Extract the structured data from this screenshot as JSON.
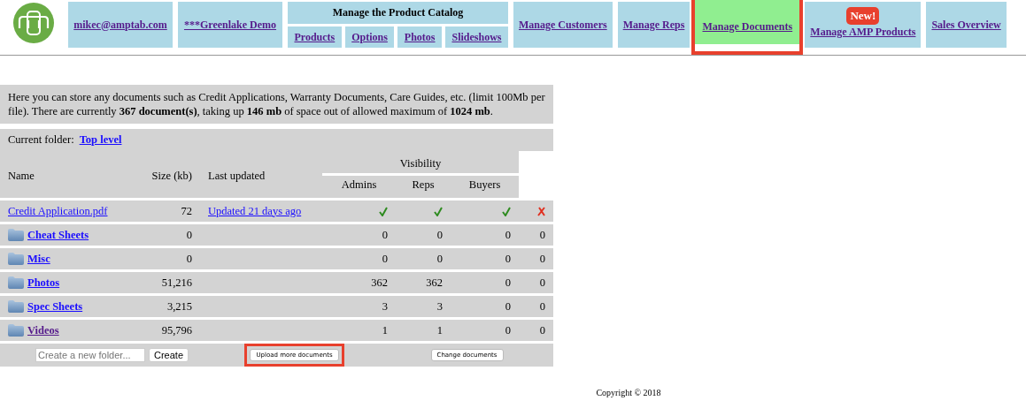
{
  "nav": {
    "user": "mikec@amptab.com",
    "account": "***Greenlake Demo",
    "catalog": {
      "title": "Manage the Product Catalog",
      "links": [
        "Products",
        "Options",
        "Photos",
        "Slideshows"
      ]
    },
    "items": [
      {
        "label": "Manage Customers",
        "selected": false,
        "highlighted": false
      },
      {
        "label": "Manage Reps",
        "selected": false,
        "highlighted": false
      },
      {
        "label": "Manage Documents",
        "selected": true,
        "highlighted": true
      },
      {
        "label": "Manage AMP Products",
        "badge": "New!",
        "selected": false,
        "highlighted": false
      },
      {
        "label": "Sales Overview",
        "selected": false,
        "highlighted": false
      }
    ]
  },
  "info": "Here you can store any documents such as Credit Applications, Warranty Documents, Care Guides, etc. (limit 100Mb per file). There are currently **367 document(s)**, taking up **146 mb** of space out of allowed maximum of **1024 mb**.",
  "current_folder": {
    "label": "Current folder:",
    "link": "Top level"
  },
  "table": {
    "columns": [
      "Name",
      "Size (kb)",
      "Last updated"
    ],
    "visibility_header": "Visibility",
    "visibility_columns": [
      "Admins",
      "Reps",
      "Buyers"
    ],
    "rows": [
      {
        "kind": "file",
        "name": "Credit Application.pdf",
        "size": "72",
        "updated": "Updated 21 days ago",
        "visited": false,
        "flags": [
          true,
          true,
          true,
          false
        ]
      },
      {
        "kind": "folder",
        "name": "Cheat Sheets",
        "size": "0",
        "visited": false,
        "counts": [
          "0",
          "0",
          "0",
          "0"
        ]
      },
      {
        "kind": "folder",
        "name": "Misc",
        "size": "0",
        "visited": false,
        "counts": [
          "0",
          "0",
          "0",
          "0"
        ]
      },
      {
        "kind": "folder",
        "name": "Photos",
        "size": "51,216",
        "visited": false,
        "counts": [
          "362",
          "362",
          "0",
          "0"
        ]
      },
      {
        "kind": "folder",
        "name": "Spec Sheets",
        "size": "3,215",
        "visited": false,
        "counts": [
          "3",
          "3",
          "0",
          "0"
        ]
      },
      {
        "kind": "folder",
        "name": "Videos",
        "size": "95,796",
        "visited": true,
        "counts": [
          "1",
          "1",
          "0",
          "0"
        ]
      }
    ]
  },
  "footer_bar": {
    "new_folder": {
      "placeholder": "Create a new folder..."
    },
    "create_button": "Create",
    "upload_button": {
      "label": "Upload more documents",
      "highlighted": true
    },
    "change_button": "Change documents"
  },
  "copyright": "Copyright © 2018"
}
